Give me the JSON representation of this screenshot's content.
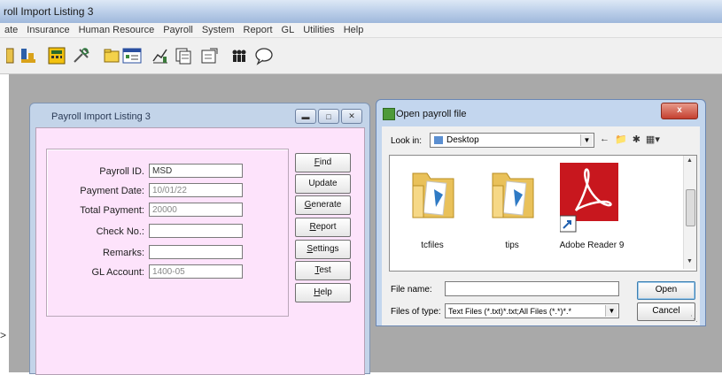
{
  "app": {
    "title": "roll Import Listing 3",
    "menu": [
      "ate",
      "Insurance",
      "Human Resource",
      "Payroll",
      "System",
      "Report",
      "GL",
      "Utilities",
      "Help"
    ]
  },
  "toolbar": {
    "icons": [
      "card-icon",
      "bank-icon",
      "calculator-icon",
      "tools-icon",
      "folder-icon",
      "form-icon",
      "chart-icon",
      "copy-icon",
      "export-icon",
      "people-icon",
      "chat-icon"
    ]
  },
  "payroll_window": {
    "title": "Payroll Import Listing 3",
    "fields": [
      {
        "label": "Payroll ID.",
        "value": "MSD"
      },
      {
        "label": "Payment Date:",
        "value": "10/01/22"
      },
      {
        "label": "Total Payment:",
        "value": "20000"
      },
      {
        "label": "Check No.:",
        "value": ""
      },
      {
        "label": "Remarks:",
        "value": ""
      },
      {
        "label": "GL Account:",
        "value": "1400-05"
      }
    ],
    "buttons": [
      {
        "hot": "F",
        "rest": "ind"
      },
      {
        "hot": "",
        "rest": "Update"
      },
      {
        "hot": "G",
        "rest": "enerate"
      },
      {
        "hot": "R",
        "rest": "eport"
      },
      {
        "hot": "S",
        "rest": "ettings"
      },
      {
        "hot": "T",
        "rest": "est"
      },
      {
        "hot": "H",
        "rest": "elp"
      }
    ]
  },
  "open_dialog": {
    "title": "Open payroll file",
    "close_label": "x",
    "look_in_label": "Look in:",
    "look_in_value": "Desktop",
    "files": [
      {
        "name": "tcfiles",
        "kind": "folder"
      },
      {
        "name": "tips",
        "kind": "folder"
      },
      {
        "name": "Adobe Reader 9",
        "kind": "adobe-shortcut"
      }
    ],
    "file_name_label": "File name:",
    "file_name_value": "",
    "file_type_label": "Files of type:",
    "file_type_value": "Text Files (*.txt)*.txt;All Files (*.*)*.*",
    "open_label": "Open",
    "cancel_label": "Cancel"
  },
  "colors": {
    "client_bg": "#fde3fb",
    "window_frame": "#c3d4e9",
    "mdi_bg": "#a9a9a9",
    "adobe_red": "#c8171e"
  }
}
